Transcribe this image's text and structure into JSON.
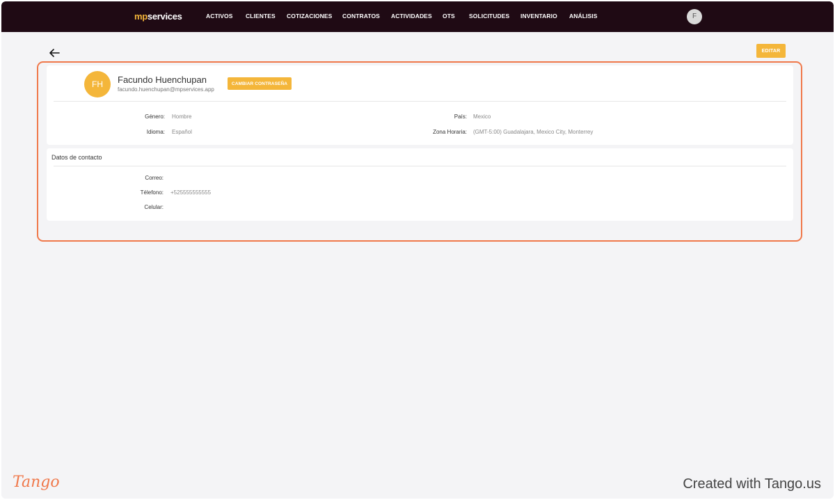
{
  "brand": {
    "prefix": "mp",
    "rest": "services"
  },
  "nav": {
    "items": [
      "ACTIVOS",
      "CLIENTES",
      "COTIZACIONES",
      "CONTRATOS",
      "ACTIVIDADES",
      "OTS",
      "SOLICITUDES",
      "INVENTARIO",
      "ANÁLISIS"
    ]
  },
  "user_avatar": "F",
  "toolbar": {
    "edit_label": "EDITAR"
  },
  "profile": {
    "initials": "FH",
    "name": "Facundo Huenchupan",
    "email": "facundo.huenchupan@mpservices.app",
    "change_password_label": "CAMBIAR CONTRASEÑA",
    "fields": {
      "gender": {
        "label": "Género:",
        "value": "Hombre"
      },
      "language": {
        "label": "Idioma:",
        "value": "Español"
      },
      "country": {
        "label": "País:",
        "value": "Mexico"
      },
      "timezone": {
        "label": "Zona Horaria:",
        "value": "(GMT-5:00) Guadalajara, Mexico City, Monterrey"
      }
    }
  },
  "contact": {
    "title": "Datos de contacto",
    "fields": {
      "email": {
        "label": "Correo:",
        "value": ""
      },
      "phone": {
        "label": "Télefono:",
        "value": "+525555555555"
      },
      "mobile": {
        "label": "Celular:",
        "value": ""
      }
    }
  },
  "footer": {
    "logo": "Tango",
    "created": "Created with Tango.us"
  },
  "colors": {
    "navbar": "#1f0a14",
    "accent": "#f4b63a",
    "highlight": "#f0784a"
  },
  "icons": {
    "back": "arrow-left-icon"
  }
}
